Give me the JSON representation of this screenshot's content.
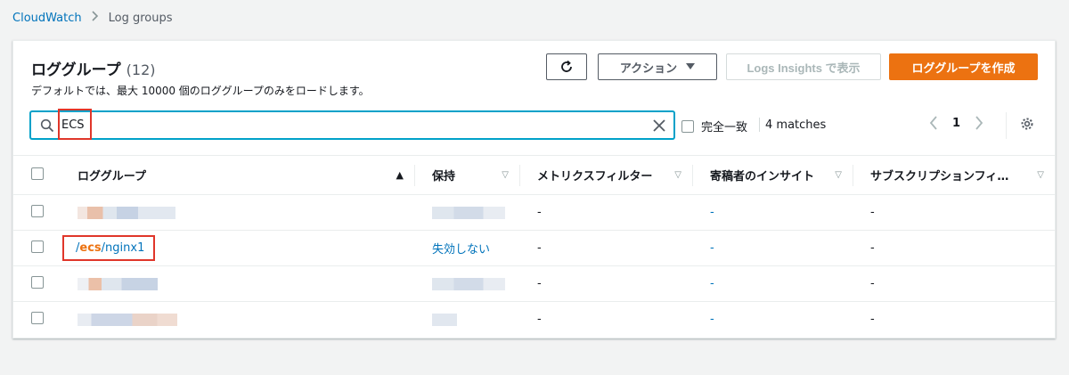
{
  "breadcrumb": {
    "root": "CloudWatch",
    "current": "Log groups"
  },
  "header": {
    "title": "ロググループ",
    "count": "(12)",
    "description": "デフォルトでは、最大 10000 個のロググループのみをロードします。"
  },
  "actions": {
    "actions_label": "アクション",
    "insights_label": "Logs Insights で表示",
    "create_label": "ロググループを作成"
  },
  "search": {
    "value": "ECS"
  },
  "filters": {
    "exact_match_label": "完全一致",
    "matches_label": "4 matches"
  },
  "pagination": {
    "current_page": "1"
  },
  "table": {
    "columns": [
      "ロググループ",
      "保持",
      "メトリクスフィルター",
      "寄稿者のインサイト",
      "サブスクリプションフィ…"
    ],
    "rows": [
      {
        "name": "",
        "retention": "",
        "metric_filter": "-",
        "contributor_insights": "-",
        "subscription": "-"
      },
      {
        "name_prefix": "/",
        "name_match": "ecs",
        "name_suffix": "/nginx1",
        "retention": "失効しない",
        "metric_filter": "-",
        "contributor_insights": "-",
        "subscription": "-"
      },
      {
        "name": "",
        "retention": "",
        "metric_filter": "-",
        "contributor_insights": "-",
        "subscription": "-"
      },
      {
        "name": "",
        "retention": "",
        "metric_filter": "-",
        "contributor_insights": "-",
        "subscription": "-"
      }
    ]
  },
  "colors": {
    "accent": "#ec7211",
    "link": "#0073bb",
    "annotation": "#e0362a",
    "focus": "#00a1c9"
  },
  "icons": [
    "refresh-icon",
    "caret-down-icon",
    "search-icon",
    "clear-icon",
    "chevron-left-icon",
    "chevron-right-icon",
    "gear-icon",
    "sort-asc-icon",
    "sort-icon"
  ]
}
